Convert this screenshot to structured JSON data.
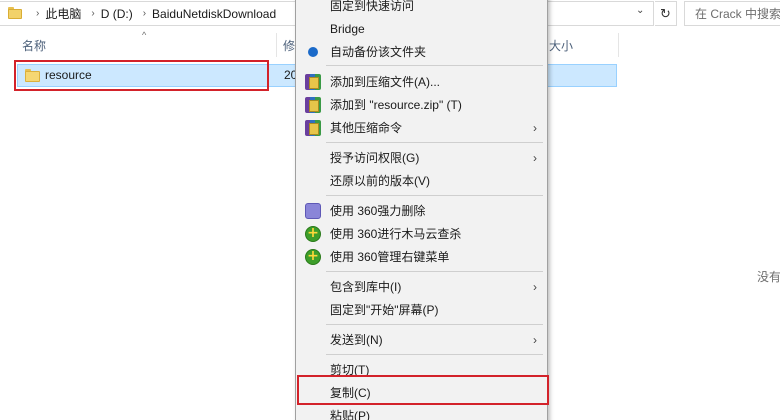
{
  "address_bar": {
    "breadcrumbs": [
      "此电脑",
      "D (D:)",
      "BaiduNetdiskDownload"
    ],
    "refresh_icon": "refresh-icon",
    "search_placeholder": "在 Crack 中搜索"
  },
  "columns": {
    "name": "名称",
    "modified": "修",
    "size": "大小"
  },
  "file": {
    "name": "resource",
    "date_fragment": "20",
    "icon": "folder-icon"
  },
  "empty_note": "没有",
  "context_menu": {
    "items": [
      {
        "label": "固定到快速访问",
        "icon": ""
      },
      {
        "label": "Bridge",
        "icon": ""
      },
      {
        "label": "自动备份该文件夹",
        "icon": "radio-icon"
      },
      {
        "label": "添加到压缩文件(A)...",
        "icon": "winrar-icon"
      },
      {
        "label": "添加到 \"resource.zip\" (T)",
        "icon": "winrar-icon"
      },
      {
        "label": "其他压缩命令",
        "icon": "winrar-icon",
        "submenu": "›"
      },
      {
        "label": "授予访问权限(G)",
        "submenu": "›"
      },
      {
        "label": "还原以前的版本(V)"
      },
      {
        "label": "使用 360强力删除",
        "icon": "shredder-icon"
      },
      {
        "label": "使用 360进行木马云查杀",
        "icon": "360-icon"
      },
      {
        "label": "使用 360管理右键菜单",
        "icon": "360-icon"
      },
      {
        "label": "包含到库中(I)",
        "submenu": "›"
      },
      {
        "label": "固定到\"开始\"屏幕(P)"
      },
      {
        "label": "发送到(N)",
        "submenu": "›"
      },
      {
        "label": "剪切(T)"
      },
      {
        "label": "复制(C)"
      },
      {
        "label": "粘贴(P)"
      }
    ]
  },
  "colors": {
    "highlight": "#d3222a",
    "selection": "#cce8ff",
    "menu_bg": "#f2f2f2"
  }
}
